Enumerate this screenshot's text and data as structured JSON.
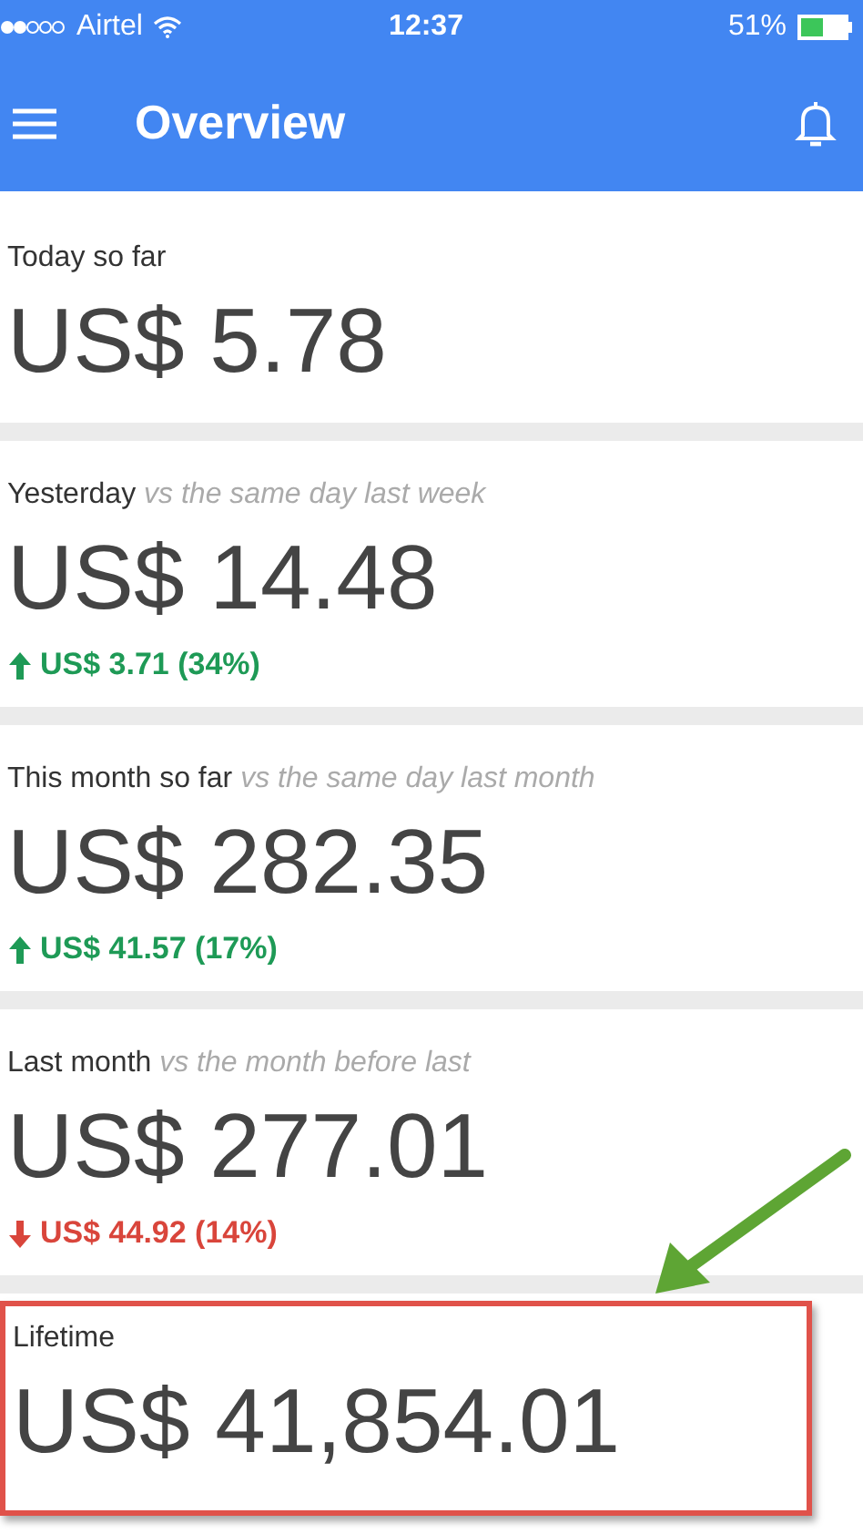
{
  "status_bar": {
    "carrier": "Airtel",
    "time": "12:37",
    "battery": "51%"
  },
  "app_bar": {
    "title": "Overview"
  },
  "cards": [
    {
      "label": "Today so far",
      "value": "US$ 5.78",
      "highlighted": false
    },
    {
      "label": "Yesterday",
      "comparison": "vs the same day last week",
      "value": "US$ 14.48",
      "change": {
        "kind": "up",
        "text": "US$ 3.71 (34%)"
      },
      "highlighted": false
    },
    {
      "label": "This month so far",
      "comparison": "vs the same day last month",
      "value": "US$ 282.35",
      "change": {
        "kind": "up",
        "text": "US$ 41.57 (17%)"
      },
      "highlighted": false
    },
    {
      "label": "Last month",
      "comparison": "vs the month before last",
      "value": "US$ 277.01",
      "change": {
        "kind": "down",
        "text": "US$ 44.92 (14%)"
      },
      "highlighted": false
    },
    {
      "label": "Lifetime",
      "value": "US$ 41,854.01",
      "highlighted": true
    }
  ]
}
